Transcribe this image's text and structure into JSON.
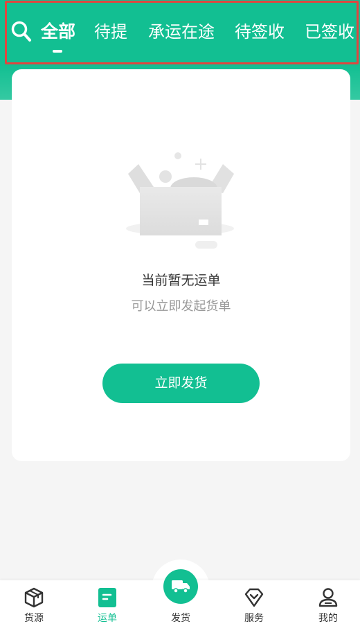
{
  "header": {
    "tabs": [
      {
        "label": "全部",
        "active": true
      },
      {
        "label": "待提",
        "active": false
      },
      {
        "label": "承运在途",
        "active": false
      },
      {
        "label": "待签收",
        "active": false
      },
      {
        "label": "已签收",
        "active": false
      }
    ],
    "search_icon": "search-icon"
  },
  "empty_state": {
    "title": "当前暂无运单",
    "subtitle": "可以立即发起货单",
    "button_label": "立即发货",
    "illustration": "empty-box-illustration"
  },
  "bottom_nav": {
    "items": [
      {
        "label": "货源",
        "icon": "cube-icon",
        "active": false
      },
      {
        "label": "运单",
        "icon": "document-icon",
        "active": true
      },
      {
        "label": "发货",
        "icon": "truck-icon",
        "active": false
      },
      {
        "label": "服务",
        "icon": "diamond-heart-icon",
        "active": false
      },
      {
        "label": "我的",
        "icon": "user-icon",
        "active": false
      }
    ]
  },
  "colors": {
    "brand": "#12bf92",
    "highlight": "#e0463f",
    "background": "#f5f5f5"
  }
}
